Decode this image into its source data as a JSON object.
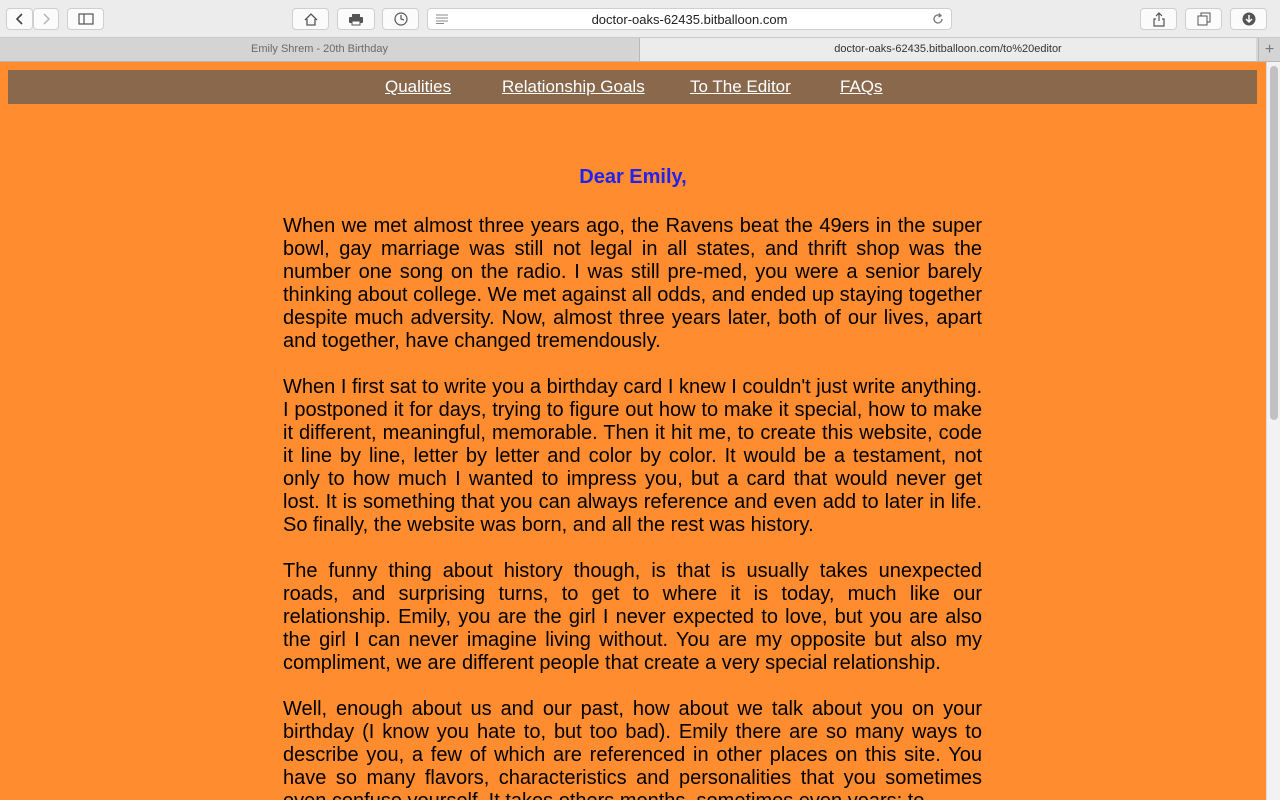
{
  "browser": {
    "url": "doctor-oaks-62435.bitballoon.com",
    "tabs": [
      {
        "title": "Emily Shrem - 20th Birthday"
      },
      {
        "title": "doctor-oaks-62435.bitballoon.com/to%20editor"
      }
    ],
    "new_tab_label": "+"
  },
  "nav": {
    "links": [
      "Qualities",
      "Relationship Goals",
      "To The Editor",
      "FAQs"
    ]
  },
  "letter": {
    "greeting": "Dear Emily,",
    "paragraphs": [
      "When we met almost three years ago, the Ravens beat the 49ers in the super bowl, gay marriage was still not legal in all states, and thrift shop was the number one song on the radio. I was still pre-med, you were a senior barely thinking about college. We met against all odds, and ended up staying together despite much adversity. Now, almost three years later, both of our lives, apart and together, have changed tremendously.",
      "When I first sat to write you a birthday card I knew I couldn't just write anything. I postponed it for days, trying to figure out how to make it special, how to make it different, meaningful, memorable. Then it hit me, to create this website, code it line by line, letter by letter and color by color. It would be a testament, not only to how much I wanted to impress you, but a card that would never get lost. It is something that you can always reference and even add to later in life. So finally, the website was born, and all the rest was history.",
      "The funny thing about history though, is that is usually takes unexpected roads, and surprising turns, to get to where it is today, much like our relationship. Emily, you are the girl I never expected to love, but you are also the girl I can never imagine living without. You are my opposite but also my compliment, we are different people that create a very special relationship.",
      "Well, enough about us and our past, how about we talk about you on your birthday (I know you hate to, but too bad). Emily there are so many ways to describe you, a few of which are referenced in other places on this site. You have so many flavors, characteristics and personalities that you sometimes even confuse yourself. It takes others months, sometimes even years; to"
    ]
  },
  "colors": {
    "page_bg": "#ff8c2e",
    "nav_bg": "#8a684c",
    "greeting": "#2222ee"
  }
}
